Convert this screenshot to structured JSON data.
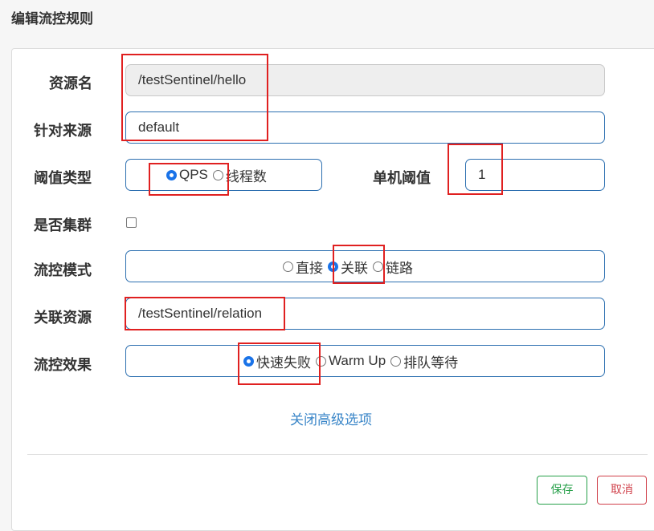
{
  "dialog": {
    "title": "编辑流控规则"
  },
  "form": {
    "resource": {
      "label": "资源名",
      "value": "/testSentinel/hello"
    },
    "limit_app": {
      "label": "针对来源",
      "value": "default"
    },
    "grade": {
      "label": "阈值类型",
      "options": [
        {
          "label": "QPS",
          "checked": true
        },
        {
          "label": "线程数",
          "checked": false
        }
      ]
    },
    "count": {
      "label": "单机阈值",
      "value": "1"
    },
    "cluster": {
      "label": "是否集群",
      "checked": false
    },
    "strategy": {
      "label": "流控模式",
      "options": [
        {
          "label": "直接",
          "checked": false
        },
        {
          "label": "关联",
          "checked": true
        },
        {
          "label": "链路",
          "checked": false
        }
      ]
    },
    "ref_resource": {
      "label": "关联资源",
      "value": "/testSentinel/relation"
    },
    "control_behavior": {
      "label": "流控效果",
      "options": [
        {
          "label": "快速失败",
          "checked": true
        },
        {
          "label": "Warm Up",
          "checked": false
        },
        {
          "label": "排队等待",
          "checked": false
        }
      ]
    },
    "advanced_toggle": "关闭高级选项"
  },
  "footer": {
    "save_label": "保存",
    "cancel_label": "取消"
  },
  "colors": {
    "accent": "#2c6fb0",
    "highlight": "#e02020",
    "save": "#27a04a",
    "cancel": "#d0404a"
  }
}
